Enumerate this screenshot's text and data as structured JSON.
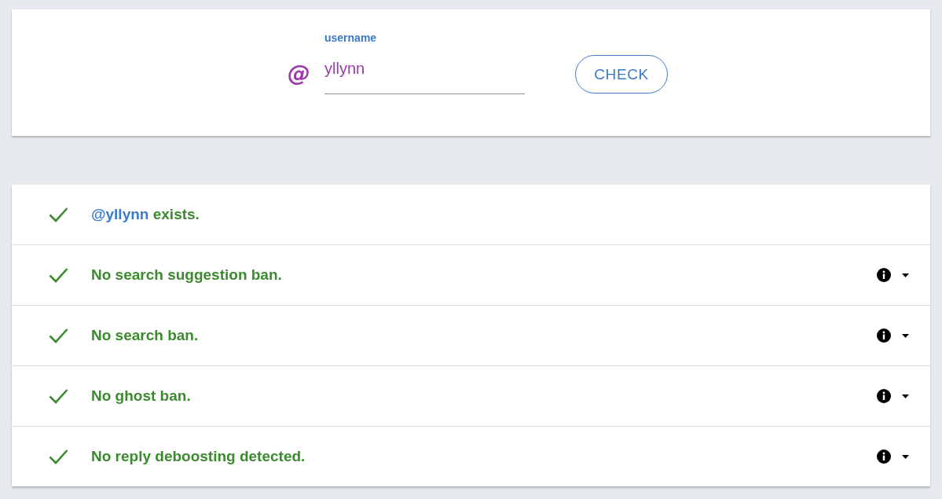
{
  "search": {
    "prefix": "@",
    "label": "username",
    "value": "yllynn",
    "button": "CHECK"
  },
  "results": [
    {
      "kind": "user",
      "passed": true,
      "handle": "@yllynn",
      "text": "exists."
    },
    {
      "kind": "ban",
      "passed": true,
      "text": "No search suggestion ban.",
      "expanded": false
    },
    {
      "kind": "ban",
      "passed": true,
      "text": "No search ban.",
      "expanded": false
    },
    {
      "kind": "ban",
      "passed": true,
      "text": "No ghost ban.",
      "expanded": false
    },
    {
      "kind": "ban",
      "passed": true,
      "text": "No reply deboosting detected.",
      "expanded": false
    }
  ]
}
